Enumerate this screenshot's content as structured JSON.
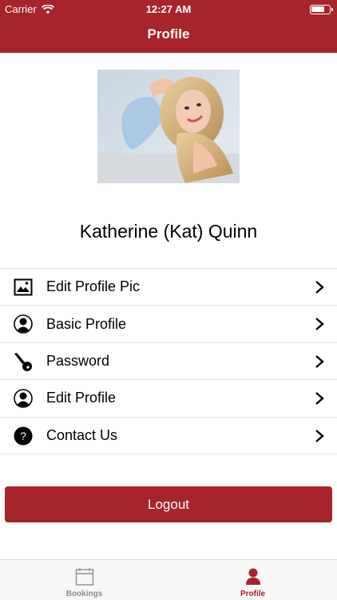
{
  "status_bar": {
    "carrier": "Carrier",
    "time": "12:27 AM",
    "battery_level": 0.75
  },
  "nav": {
    "title": "Profile"
  },
  "profile": {
    "name": "Katherine (Kat) Quinn"
  },
  "menu": [
    {
      "label": "Edit Profile Pic",
      "icon": "image-icon"
    },
    {
      "label": "Basic Profile",
      "icon": "person-icon"
    },
    {
      "label": "Password",
      "icon": "key-icon"
    },
    {
      "label": "Edit Profile",
      "icon": "person-icon"
    },
    {
      "label": "Contact Us",
      "icon": "question-icon"
    }
  ],
  "logout_label": "Logout",
  "tabs": [
    {
      "label": "Bookings",
      "icon": "calendar-icon",
      "active": false
    },
    {
      "label": "Profile",
      "icon": "person-icon",
      "active": true
    }
  ],
  "colors": {
    "brand": "#a7242a",
    "tab_inactive": "#8e8e93",
    "divider": "#e5e5e5"
  }
}
